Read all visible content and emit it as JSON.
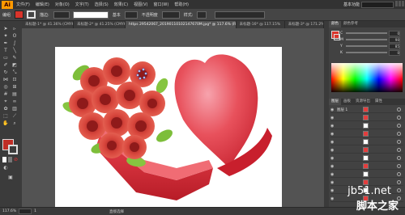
{
  "app": {
    "logo": "Ai"
  },
  "menubar": {
    "items": [
      "文件(F)",
      "编辑(E)",
      "对象(O)",
      "文字(T)",
      "选择(S)",
      "效果(C)",
      "视图(V)",
      "窗口(W)",
      "帮助(H)"
    ],
    "workspace": "基本功能"
  },
  "controlbar": {
    "object_label": "编组",
    "stroke_label": "描边:",
    "style_label": "基本",
    "opacity_label": "不透明度",
    "style2_label": "样式:"
  },
  "tabs": [
    {
      "label": "未标题-1* @ 41.36% (CMYK/预览)",
      "active": false
    },
    {
      "label": "未标题-2* @ 41.25% (CMYK/预览)",
      "active": false
    },
    {
      "label": "https 29542067_20190110102147670M.jpg* @ 117.6% (RGB/预览)",
      "active": true
    },
    {
      "label": "未标题-16* @ 117.15%",
      "active": false
    },
    {
      "label": "未标题-3* @ 171.2% (CMYK/预览)",
      "active": false
    }
  ],
  "status": {
    "zoom": "117.6%",
    "page": "1",
    "tool": "直接选择"
  },
  "panel": {
    "tabs_top": [
      "颜色",
      "颜色参考"
    ],
    "color_rows": [
      {
        "label": "C",
        "value": "0"
      },
      {
        "label": "M",
        "value": "90"
      },
      {
        "label": "Y",
        "value": "85"
      },
      {
        "label": "K",
        "value": "0"
      }
    ],
    "tabs_layers": [
      "图层",
      "画板",
      "资源导出",
      "属性"
    ],
    "layers": [
      {
        "name": "图层 1",
        "thumb": "red"
      },
      {
        "name": "",
        "thumb": "red"
      },
      {
        "name": "",
        "thumb": "white"
      },
      {
        "name": "",
        "thumb": "red"
      },
      {
        "name": "",
        "thumb": "white"
      },
      {
        "name": "",
        "thumb": "red"
      },
      {
        "name": "",
        "thumb": "white"
      },
      {
        "name": "",
        "thumb": "red"
      },
      {
        "name": "",
        "thumb": "white"
      },
      {
        "name": "",
        "thumb": "red"
      },
      {
        "name": "",
        "thumb": "white"
      },
      {
        "name": "",
        "thumb": "red"
      }
    ]
  },
  "watermark": {
    "url": "jb51.net",
    "site": "脚本之家"
  },
  "colors": {
    "accent": "#ff9a00",
    "fill": "#bf2d26",
    "heart": "#e23b44"
  }
}
